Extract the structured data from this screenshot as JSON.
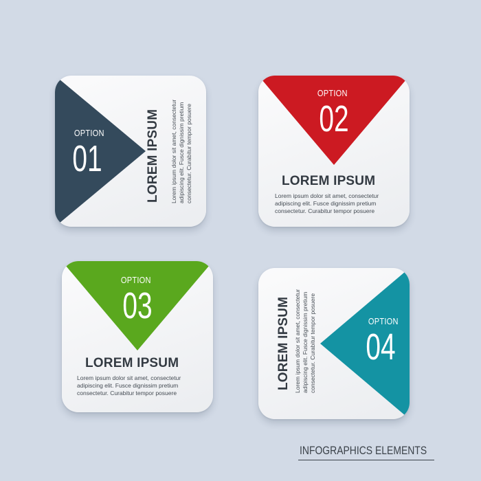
{
  "colors": {
    "option1": "#344a5c",
    "option2": "#cc1a22",
    "option3": "#5aa81e",
    "option4": "#1493a3",
    "background": "#d2dae6"
  },
  "cards": [
    {
      "option_label": "OPTION",
      "number": "01",
      "title": "LOREM IPSUM",
      "body": [
        "Lorem ipsum dolor sit amet, consectetur",
        "adipiscing elit. Fusce dignissim pretium",
        "consectetur. Curabitur tempor posuere"
      ]
    },
    {
      "option_label": "OPTION",
      "number": "02",
      "title": "LOREM IPSUM",
      "body": [
        "Lorem ipsum dolor sit amet, consectetur",
        "adipiscing elit. Fusce dignissim pretium",
        "consectetur. Curabitur tempor posuere"
      ]
    },
    {
      "option_label": "OPTION",
      "number": "03",
      "title": "LOREM IPSUM",
      "body": [
        "Lorem ipsum dolor sit amet, consectetur",
        "adipiscing elit. Fusce dignissim pretium",
        "consectetur. Curabitur tempor posuere"
      ]
    },
    {
      "option_label": "OPTION",
      "number": "04",
      "title": "LOREM IPSUM",
      "body": [
        "Lorem ipsum dolor sit amet, consectetur",
        "adipiscing elit. Fusce dignissim pretium",
        "consectetur. Curabitur tempor posuere"
      ]
    }
  ],
  "footer": {
    "text": "INFOGRAPHICS ELEMENTS"
  }
}
